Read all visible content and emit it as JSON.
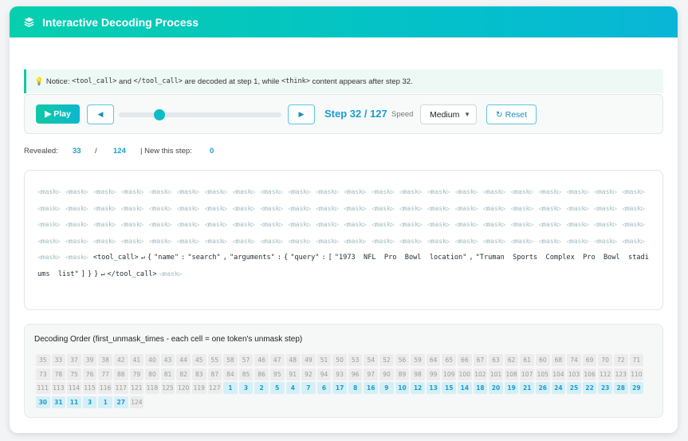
{
  "header": {
    "title": "Interactive Decoding Process",
    "icon": "layers-icon"
  },
  "notice": {
    "icon": "lightbulb-icon",
    "prefix": "Notice: ",
    "code1": "<tool_call>",
    "t1": " and ",
    "code2": "</tool_call>",
    "t2": " are decoded at step 1, while ",
    "code3": "<think>",
    "t3": " content appears after step 32."
  },
  "controls": {
    "play_label": "▶ Play",
    "prev_label": "◀",
    "next_label": "▶",
    "step_label": "Step 32 / 127",
    "current_step": 32,
    "total_steps": 127,
    "speed_label": "Speed",
    "speed_value": "Medium",
    "reset_label": "↻ Reset"
  },
  "stats": {
    "revealed_label": "Revealed:",
    "revealed": "33",
    "sep": "/",
    "total": "124",
    "new_label": "| New this step:",
    "new": "0"
  },
  "tokens": {
    "mask_token": "◁mask▷",
    "masked_before": 90,
    "masked_after": 1,
    "revealed": [
      "<tool_call>",
      "↵",
      "{",
      "\"name\"",
      ":",
      "\"search\"",
      ",",
      "\"arguments\"",
      ":",
      "{",
      "\"query\"",
      ":",
      "[",
      "\"1973  NFL  Pro  Bowl  location\"",
      ",",
      "\"Truman  Sports  Complex  Pro  Bowl  stadiums  list\"",
      "]",
      "}",
      "}",
      "↵",
      "</tool_call>"
    ]
  },
  "order": {
    "title": "Decoding Order (first_unmask_times - each cell = one token's unmask step)",
    "current_step": 32,
    "values": [
      35,
      33,
      37,
      39,
      38,
      42,
      41,
      40,
      43,
      44,
      45,
      55,
      58,
      57,
      46,
      47,
      48,
      49,
      51,
      50,
      53,
      54,
      52,
      56,
      59,
      64,
      65,
      66,
      67,
      63,
      62,
      61,
      60,
      68,
      74,
      69,
      70,
      72,
      71,
      73,
      78,
      75,
      76,
      77,
      88,
      79,
      80,
      81,
      82,
      83,
      87,
      84,
      85,
      86,
      95,
      91,
      92,
      94,
      93,
      96,
      97,
      90,
      89,
      98,
      99,
      109,
      100,
      102,
      101,
      108,
      107,
      105,
      104,
      103,
      106,
      112,
      123,
      110,
      111,
      113,
      114,
      115,
      116,
      117,
      121,
      118,
      125,
      120,
      119,
      127,
      1,
      3,
      2,
      5,
      4,
      7,
      6,
      17,
      8,
      16,
      9,
      10,
      12,
      13,
      15,
      14,
      18,
      20,
      19,
      21,
      26,
      24,
      25,
      22,
      23,
      28,
      29,
      30,
      31,
      11,
      3,
      1,
      27,
      124
    ]
  },
  "colors": {
    "accent": "#1a9dd0",
    "header_start": "#06cfae",
    "header_end": "#09b6d6",
    "revealed_cell": "#d5eff7"
  }
}
